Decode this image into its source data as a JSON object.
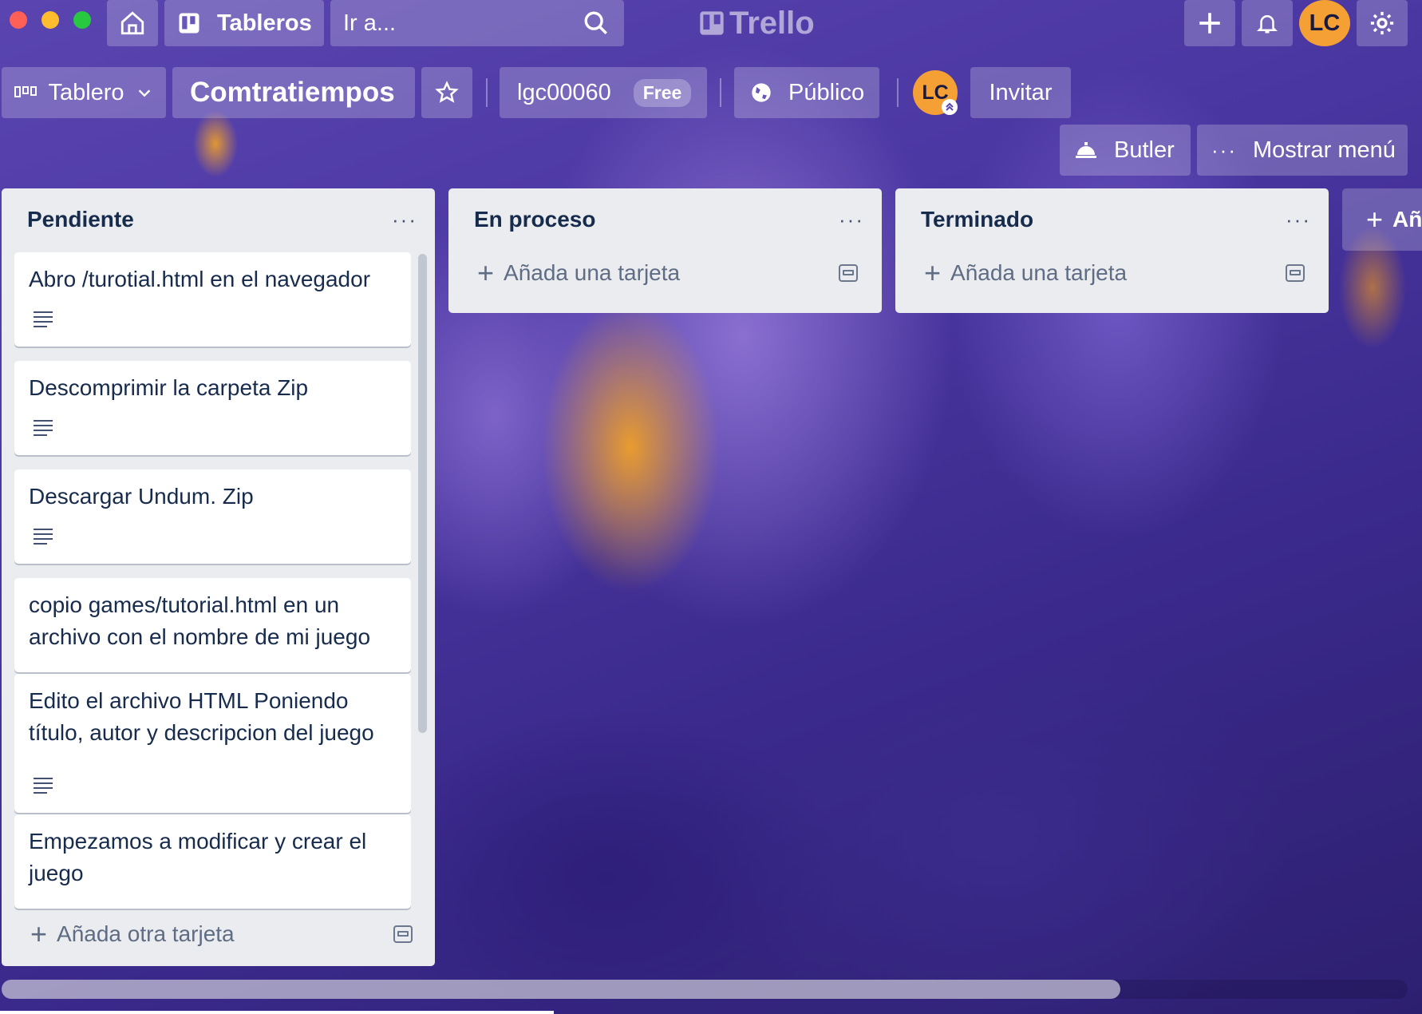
{
  "topbar": {
    "boards_label": "Tableros",
    "search_placeholder": "Ir a...",
    "logo": "Trello",
    "avatar_initials": "LC"
  },
  "board": {
    "view_label": "Tablero",
    "title": "Comtratiempos",
    "workspace": "lgc00060",
    "plan": "Free",
    "visibility": "Público",
    "member_initials": "LC",
    "invite_label": "Invitar",
    "butler_label": "Butler",
    "menu_label": "Mostrar menú",
    "add_list_partial": "Añ"
  },
  "lists": [
    {
      "title": "Pendiente",
      "cards": [
        {
          "title": "Abro /turotial.html en el navegador",
          "has_description": true
        },
        {
          "title": "Descomprimir la carpeta Zip",
          "has_description": true
        },
        {
          "title": "Descargar Undum. Zip",
          "has_description": true
        },
        {
          "title": "copio games/tutorial.html en un archivo con el nombre de mi juego",
          "has_description": false
        },
        {
          "title": "Edito el archivo HTML Poniendo título, autor y descripcion del juego",
          "has_description": true
        },
        {
          "title": "Empezamos a modificar y crear el juego",
          "has_description": false
        }
      ],
      "add_label": "Añada otra tarjeta"
    },
    {
      "title": "En proceso",
      "cards": [],
      "add_label": "Añada una tarjeta"
    },
    {
      "title": "Terminado",
      "cards": [],
      "add_label": "Añada una tarjeta"
    }
  ],
  "colors": {
    "accent_orange": "#f4a035",
    "list_bg": "#ebecf0",
    "text_dark": "#172b4d"
  }
}
